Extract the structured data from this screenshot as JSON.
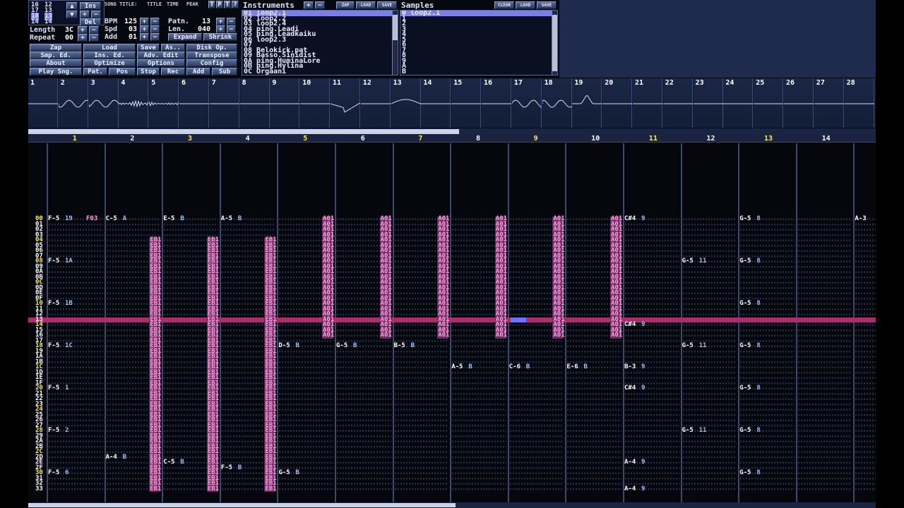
{
  "positions": {
    "items": [
      "16",
      "17",
      "18",
      "14"
    ],
    "cols": [
      "12",
      "13",
      "13",
      "14"
    ],
    "ins_label": "Ins",
    "del_label": "Del"
  },
  "song": {
    "length_label": "Length",
    "length_value": "3C",
    "repeat_label": "Repeat",
    "repeat_value": "00",
    "bpm_label": "BPM",
    "bpm_value": "125",
    "spd_label": "Spd",
    "spd_value": "03",
    "add_label": "Add",
    "add_value": "01",
    "patn_label": "Patn.",
    "patn_value": "13",
    "len_label": "Len.",
    "len_value": "040",
    "expand_label": "Expand",
    "shrink_label": "Shrink",
    "tabs": [
      "SONG TITLE:",
      "TITLE",
      "TIME",
      "PEAK"
    ]
  },
  "menu": {
    "rows": [
      [
        "Zap",
        "Load",
        "Save",
        "As..",
        "Disk Op."
      ],
      [
        "Smp. Ed.",
        "Ins. Ed.",
        "Adv. Edit",
        "Transpose"
      ],
      [
        "About",
        "Optimize",
        "Options",
        "Config"
      ],
      [
        "Play Sng.",
        "Pat.",
        "Pos",
        "Stop",
        "Rec",
        "Add",
        "Sub"
      ]
    ]
  },
  "instruments": {
    "title": "Instruments",
    "buttons": [
      "ZAP",
      "LOAD",
      "SAVE"
    ],
    "items": [
      "01 loop2.1",
      "02 loop2.2",
      "03 loop2.4",
      "04 ping.Leadi",
      "05 ping.Leadkaiku",
      "06 loop2.3",
      "07",
      "08 Belokick.pat",
      "09 Basso.Sinidist",
      "0A ping.HuminaLore",
      "0B ping.Hylina",
      "0C Orgaani"
    ],
    "selected": 0
  },
  "samples": {
    "title": "Samples",
    "buttons": [
      "CLEAR",
      "LOAD",
      "SAVE"
    ],
    "items": [
      "0 loop2.1",
      "1",
      "2",
      "3",
      "4",
      "5",
      "6",
      "7",
      "8",
      "9",
      "A",
      "B"
    ],
    "selected": 0
  },
  "scopes": {
    "labels": [
      "1",
      "2",
      "3",
      "4",
      "5",
      "6",
      "7",
      "8",
      "9",
      "10",
      "11",
      "12",
      "13",
      "14",
      "15",
      "16",
      "17",
      "18",
      "19",
      "20",
      "21",
      "22",
      "23",
      "24",
      "25",
      "26",
      "27",
      "28"
    ]
  },
  "channels": {
    "labels": [
      "1",
      "2",
      "3",
      "4",
      "5",
      "6",
      "7",
      "8",
      "9",
      "10",
      "11",
      "12",
      "13",
      "14"
    ],
    "highlighted": [
      "1",
      "3",
      "5",
      "7",
      "9",
      "11",
      "13"
    ]
  },
  "rows": [
    "00",
    "01",
    "02",
    "03",
    "04",
    "05",
    "06",
    "07",
    "08",
    "09",
    "0A",
    "0B",
    "0C",
    "0D",
    "0E",
    "0F",
    "10",
    "11",
    "12",
    "13",
    "14",
    "15",
    "16",
    "17",
    "18",
    "19",
    "1A",
    "1B",
    "1C",
    "1D",
    "1E",
    "1F",
    "20",
    "21",
    "22",
    "23",
    "24",
    "25",
    "26",
    "27",
    "28",
    "29",
    "2A",
    "2B",
    "2C",
    "2D",
    "2E",
    "2F",
    "30",
    "31",
    "32",
    "33"
  ],
  "cells": [
    {
      "row": 0,
      "col": 0,
      "note": "F-5",
      "ins": "19",
      "fx": "F03"
    },
    {
      "row": 0,
      "col": 1,
      "note": "C-5",
      "ins": "A"
    },
    {
      "row": 0,
      "col": 2,
      "note": "E-5",
      "ins": "B"
    },
    {
      "row": 0,
      "col": 3,
      "note": "A-5",
      "ins": "B"
    },
    {
      "row": 0,
      "col": 10,
      "note": "C#4",
      "ins": "9"
    },
    {
      "row": 0,
      "col": 12,
      "note": "G-5",
      "ins": "8"
    },
    {
      "row": 0,
      "col": 14,
      "note": "A-3"
    },
    {
      "row": 8,
      "col": 0,
      "note": "F-5",
      "ins": "1A"
    },
    {
      "row": 8,
      "col": 11,
      "note": "G-5",
      "ins": "11"
    },
    {
      "row": 8,
      "col": 12,
      "note": "G-5",
      "ins": "8"
    },
    {
      "row": 16,
      "col": 0,
      "note": "F-5",
      "ins": "1B"
    },
    {
      "row": 16,
      "col": 12,
      "note": "G-5",
      "ins": "8"
    },
    {
      "row": 20,
      "col": 10,
      "note": "C#4",
      "ins": "9"
    },
    {
      "row": 24,
      "col": 0,
      "note": "F-5",
      "ins": "1C"
    },
    {
      "row": 24,
      "col": 4,
      "note": "D-5",
      "ins": "B"
    },
    {
      "row": 24,
      "col": 5,
      "note": "G-5",
      "ins": "B"
    },
    {
      "row": 24,
      "col": 6,
      "note": "B-5",
      "ins": "B"
    },
    {
      "row": 24,
      "col": 11,
      "note": "G-5",
      "ins": "11"
    },
    {
      "row": 24,
      "col": 12,
      "note": "G-5",
      "ins": "8"
    },
    {
      "row": 28,
      "col": 7,
      "note": "A-5",
      "ins": "B"
    },
    {
      "row": 28,
      "col": 8,
      "note": "C-6",
      "ins": "B"
    },
    {
      "row": 28,
      "col": 9,
      "note": "E-6",
      "ins": "B"
    },
    {
      "row": 28,
      "col": 10,
      "note": "B-3",
      "ins": "9"
    },
    {
      "row": 32,
      "col": 0,
      "note": "F-5",
      "ins": "1"
    },
    {
      "row": 32,
      "col": 10,
      "note": "C#4",
      "ins": "9"
    },
    {
      "row": 32,
      "col": 12,
      "note": "G-5",
      "ins": "8"
    },
    {
      "row": 40,
      "col": 0,
      "note": "F-5",
      "ins": "2"
    },
    {
      "row": 40,
      "col": 11,
      "note": "G-5",
      "ins": "11"
    },
    {
      "row": 40,
      "col": 12,
      "note": "G-5",
      "ins": "8"
    },
    {
      "row": 45,
      "col": 1,
      "note": "A-4",
      "ins": "B"
    },
    {
      "row": 46,
      "col": 2,
      "note": "C-5",
      "ins": "B"
    },
    {
      "row": 47,
      "col": 3,
      "note": "F-5",
      "ins": "B"
    },
    {
      "row": 46,
      "col": 10,
      "note": "A-4",
      "ins": "9"
    },
    {
      "row": 48,
      "col": 0,
      "note": "F-5",
      "ins": "6"
    },
    {
      "row": 48,
      "col": 4,
      "note": "G-5",
      "ins": "B"
    },
    {
      "row": 48,
      "col": 12,
      "note": "G-5",
      "ins": "8"
    },
    {
      "row": 51,
      "col": 10,
      "note": "A-4",
      "ins": "9"
    }
  ],
  "fxcolumns": [
    {
      "col": 2,
      "from": 4,
      "to": 51,
      "text": "EB1"
    },
    {
      "col": 3,
      "from": 4,
      "to": 51,
      "text": "EB1"
    },
    {
      "col": 4,
      "from": 4,
      "to": 51,
      "text": "EB1"
    },
    {
      "col": 5,
      "from": 0,
      "to": 22,
      "text": "A01"
    },
    {
      "col": 6,
      "from": 0,
      "to": 22,
      "text": "A01"
    },
    {
      "col": 7,
      "from": 0,
      "to": 22,
      "text": "A01"
    },
    {
      "col": 8,
      "from": 0,
      "to": 22,
      "text": "A01"
    },
    {
      "col": 9,
      "from": 0,
      "to": 22,
      "text": "A01"
    },
    {
      "col": 10,
      "from": 0,
      "to": 22,
      "text": "A01"
    }
  ],
  "current_row": 19,
  "colors": {
    "accent": "#a72f6d",
    "cursor": "#6f73ff",
    "highlight_num": "#ffec5a"
  }
}
